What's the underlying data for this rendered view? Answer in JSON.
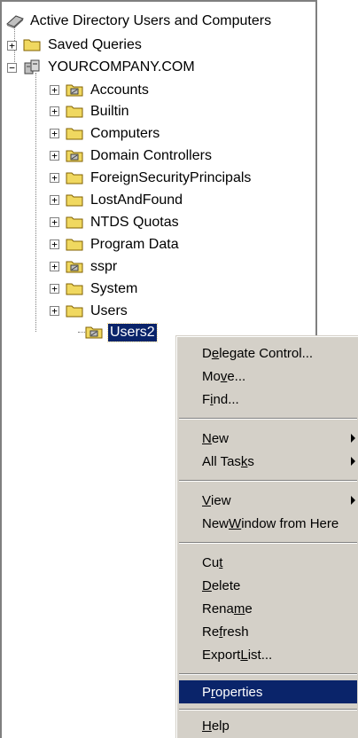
{
  "tree": {
    "root_label": "Active Directory Users and Computers",
    "items": [
      {
        "label": "Saved Queries",
        "icon": "folder-icon"
      },
      {
        "label": "YOURCOMPANY.COM",
        "icon": "domain-icon"
      }
    ],
    "domain_children": [
      {
        "label": "Accounts",
        "icon": "ou-icon"
      },
      {
        "label": "Builtin",
        "icon": "folder-icon"
      },
      {
        "label": "Computers",
        "icon": "folder-icon"
      },
      {
        "label": "Domain Controllers",
        "icon": "ou-icon"
      },
      {
        "label": "ForeignSecurityPrincipals",
        "icon": "folder-icon"
      },
      {
        "label": "LostAndFound",
        "icon": "folder-icon"
      },
      {
        "label": "NTDS Quotas",
        "icon": "folder-icon"
      },
      {
        "label": "Program Data",
        "icon": "folder-icon"
      },
      {
        "label": "sspr",
        "icon": "ou-icon"
      },
      {
        "label": "System",
        "icon": "folder-icon"
      },
      {
        "label": "Users",
        "icon": "folder-icon"
      },
      {
        "label": "Users2",
        "icon": "ou-icon",
        "selected": true
      }
    ]
  },
  "context_menu": {
    "items": [
      {
        "label": "Delegate Control...",
        "pre": "D",
        "acc": "e",
        "post": "legate Control..."
      },
      {
        "label": "Move...",
        "pre": "Mo",
        "acc": "v",
        "post": "e..."
      },
      {
        "label": "Find...",
        "pre": "F",
        "acc": "i",
        "post": "nd..."
      },
      {
        "label": "New",
        "pre": "",
        "acc": "N",
        "post": "ew",
        "submenu": true
      },
      {
        "label": "All Tasks",
        "pre": "All Tas",
        "acc": "k",
        "post": "s",
        "submenu": true
      },
      {
        "label": "View",
        "pre": "",
        "acc": "V",
        "post": "iew",
        "submenu": true
      },
      {
        "label": "New Window from Here",
        "pre": "New ",
        "acc": "W",
        "post": "indow from Here"
      },
      {
        "label": "Cut",
        "pre": "Cu",
        "acc": "t",
        "post": ""
      },
      {
        "label": "Delete",
        "pre": "",
        "acc": "D",
        "post": "elete"
      },
      {
        "label": "Rename",
        "pre": "Rena",
        "acc": "m",
        "post": "e"
      },
      {
        "label": "Refresh",
        "pre": "Re",
        "acc": "f",
        "post": "resh"
      },
      {
        "label": "Export List...",
        "pre": "Export ",
        "acc": "L",
        "post": "ist..."
      },
      {
        "label": "Properties",
        "pre": "P",
        "acc": "r",
        "post": "operties",
        "highlighted": true
      },
      {
        "label": "Help",
        "pre": "",
        "acc": "H",
        "post": "elp"
      }
    ]
  },
  "colors": {
    "selection": "#0a246a",
    "menu_background": "#d4d0c8",
    "folder": "#f0d860"
  }
}
